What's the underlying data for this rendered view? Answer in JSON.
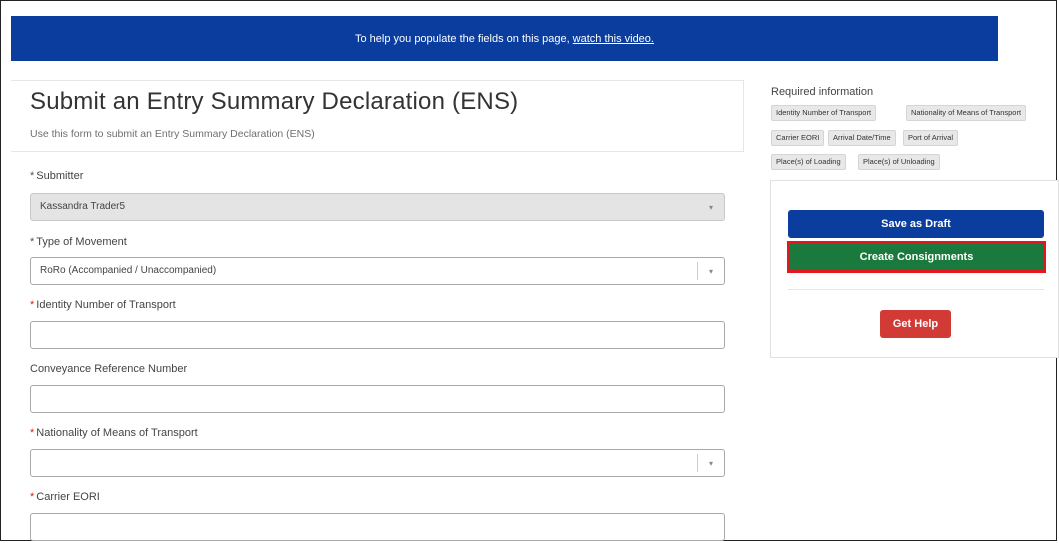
{
  "banner": {
    "text": "To help you populate the fields on this page,",
    "link": "watch this video."
  },
  "form": {
    "title": "Submit an Entry Summary Declaration (ENS)",
    "subtitle": "Use this form to submit an Entry Summary Declaration (ENS)",
    "fields": {
      "submitter": {
        "label": "Submitter",
        "required_mark": "*",
        "value": "Kassandra Trader5"
      },
      "type_of_movement": {
        "label": "Type of Movement",
        "required_mark": "*",
        "value": "RoRo (Accompanied / Unaccompanied)"
      },
      "identity_number": {
        "label": "Identity Number of Transport",
        "required_mark": "*",
        "value": ""
      },
      "conveyance_ref": {
        "label": "Conveyance Reference Number",
        "value": ""
      },
      "nationality": {
        "label": "Nationality of Means of Transport",
        "required_mark": "*",
        "value": ""
      },
      "carrier_eori": {
        "label": "Carrier EORI",
        "required_mark": "*",
        "value": ""
      }
    },
    "select_arrow": "▾"
  },
  "required_info": {
    "title": "Required information",
    "tags": [
      "Identity Number of Transport",
      "Nationality of Means of Transport",
      "Carrier EORI",
      "Arrival Date/Time",
      "Port of Arrival",
      "Place(s) of Loading",
      "Place(s) of Unloading"
    ]
  },
  "actions": {
    "save_draft": "Save as Draft",
    "create_consignments": "Create Consignments",
    "get_help": "Get Help"
  },
  "colors": {
    "banner": "#0a3d9e",
    "save_draft": "#0a3d9e",
    "create_consignments": "#1a7a3e",
    "highlight_border": "#e4161f",
    "get_help": "#d23a36",
    "required_asterisk": "#d0281e"
  }
}
